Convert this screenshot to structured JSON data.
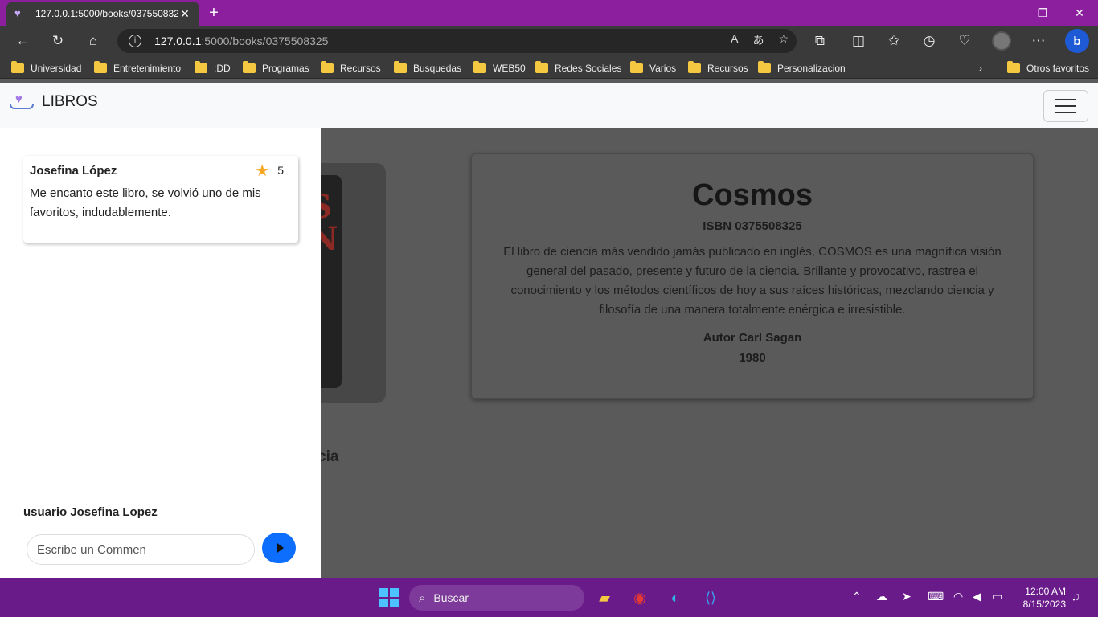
{
  "browser": {
    "tab_title": "127.0.0.1:5000/books/037550832",
    "address_host": "127.0.0.1",
    "address_path": ":5000/books/0375508325",
    "bookmarks": [
      "Universidad",
      "Entretenimiento",
      ":DD",
      "Programas",
      "Recursos",
      "Busquedas",
      "WEB50",
      "Redes Sociales",
      "Varios",
      "Recursos",
      "Personalizacion"
    ],
    "other_favorites": "Otros favoritos"
  },
  "navbar": {
    "brand": "LIBROS"
  },
  "book": {
    "title": "Cosmos",
    "isbn": "ISBN 0375508325",
    "description": "El libro de ciencia más vendido jamás publicado en inglés, COSMOS es una magnífica visión general del pasado, presente y futuro de la ciencia. Brillante y provocativo, rastrea el conocimiento y los métodos científicos de hoy a sus raíces históricas, mezclando ciencia y filosofía de una manera totalmente enérgica e irresistible.",
    "author": "Autor Carl Sagan",
    "year": "1980",
    "partial_label": "cia"
  },
  "comments_panel": {
    "comments": [
      {
        "author": "Josefina López",
        "rating": "5",
        "text": "Me encanto este libro, se volvió uno de mis favoritos, indudablemente."
      }
    ],
    "user_label": "usuario Josefina Lopez",
    "input_placeholder": "Escribe un Commen"
  },
  "taskbar": {
    "search_placeholder": "Buscar",
    "time": "12:00 AM",
    "date": "8/15/2023"
  },
  "colors": {
    "tab_strip": "#8b1f9e",
    "taskbar": "#6a1b8a",
    "send_button": "#0d6efd",
    "star": "#f5a623"
  }
}
